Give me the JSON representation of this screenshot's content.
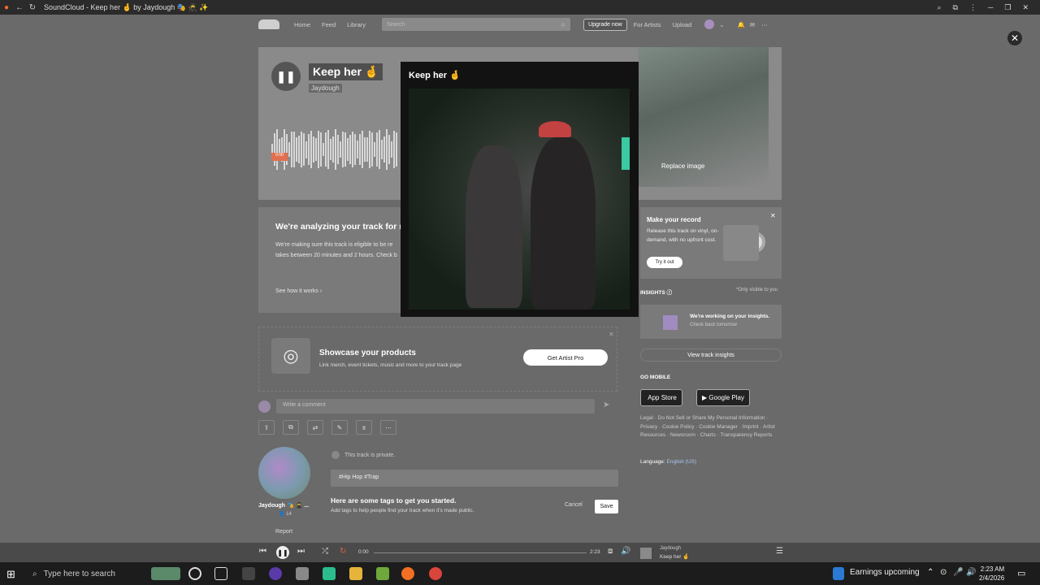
{
  "browser": {
    "title": "SoundCloud - Keep her 🤞 by Jaydough 🎭 🥷 ✨"
  },
  "nav": {
    "links": [
      "Home",
      "Feed",
      "Library"
    ],
    "search_placeholder": "Search",
    "upgrade": "Upgrade now",
    "for_artists": "For Artists",
    "upload": "Upload"
  },
  "hero": {
    "title": "Keep her 🤞",
    "artist": "Jaydough",
    "time_badge": "0:00",
    "replace_image": "Replace image"
  },
  "modal": {
    "title": "Keep her 🤞"
  },
  "analyze": {
    "title": "We're analyzing your track for re",
    "body": "We're making sure this track is eligible to be re takes between 20 minutes and 2 hours. Check b",
    "see_how": "See how it works"
  },
  "showcase": {
    "title": "Showcase your products",
    "subtitle": "Link merch, event tickets, music and more to your track page",
    "cta": "Get Artist Pro"
  },
  "comment": {
    "placeholder": "Write a comment"
  },
  "artist": {
    "name": "Jaydough 🎭 🥷 ...",
    "followers": "14",
    "report": "Report"
  },
  "track": {
    "private_text": "This track is private.",
    "tags": "#Hip Hop  #Trap",
    "tags_hint_title": "Here are some tags to get you started.",
    "tags_hint_desc": "Add tags to help people find your track when it's made public.",
    "cancel": "Cancel",
    "save": "Save"
  },
  "vinyl": {
    "title": "Make your record",
    "body": "Release this track on vinyl, on-demand, with no upfront cost.",
    "cta": "Try it out"
  },
  "insights": {
    "label": "INSIGHTS",
    "only_visible": "*Only visible to you",
    "working": "We're working on your insights.",
    "check_back": "Check back tomorrow",
    "view": "View track insights"
  },
  "mobile": {
    "label": "GO MOBILE",
    "app_store": "App Store",
    "google_play": "Google Play"
  },
  "footer": {
    "links": "Legal · Do Not Sell or Share My Personal Information · Privacy · Cookie Policy · Cookie Manager · Imprint · Artist Resources · Newsroom · Charts · Transparency Reports",
    "language_label": "Language:",
    "language_value": "English (US)"
  },
  "player": {
    "current": "0:00",
    "duration": "2:23",
    "artist": "Jaydough",
    "track": "Keep her 🤞",
    "progress": 0
  },
  "taskbar": {
    "search": "Type here to search",
    "news": "Earnings upcoming",
    "time": "2:23 AM",
    "date": "2/4/2026"
  }
}
